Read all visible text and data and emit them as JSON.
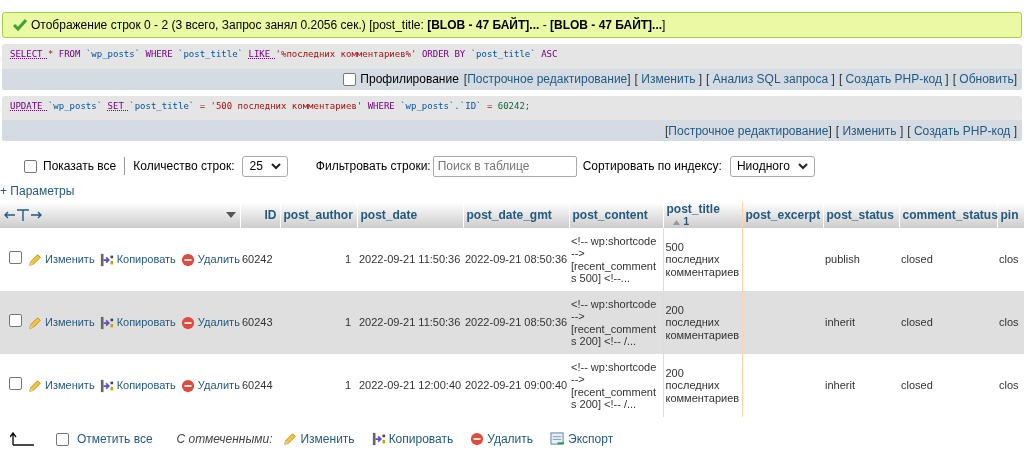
{
  "message": {
    "text": "Отображение строк 0 - 2 (3 всего, Запрос занял 0.2056 сек.) [post_title: **[BLOB - 47 БАЙТ]...** - **[BLOB - 47 БАЙТ]...**]"
  },
  "queries": [
    {
      "sql": [
        {
          "text": "SELECT",
          "kind": "keyword"
        },
        {
          "text": "*",
          "kind": "operator"
        },
        {
          "text": "FROM",
          "kind": "keyword2"
        },
        {
          "text": "`wp_posts`",
          "kind": "ident"
        },
        {
          "text": "WHERE",
          "kind": "keyword2"
        },
        {
          "text": "`post_title`",
          "kind": "ident"
        },
        {
          "text": "LIKE",
          "kind": "keyword"
        },
        {
          "text": "'%последних комментариев%'",
          "kind": "string"
        },
        {
          "text": "ORDER BY",
          "kind": "keyword2"
        },
        {
          "text": "`post_title`",
          "kind": "ident"
        },
        {
          "text": "ASC",
          "kind": "keyword2"
        }
      ],
      "profiling": {
        "label": "Профилирование",
        "checked": false
      },
      "links": [
        {
          "open": "[",
          "label": "Построчное редактирование",
          "close": "]"
        },
        {
          "open": "[ ",
          "label": "Изменить",
          "close": " ]"
        },
        {
          "open": "[ ",
          "label": "Анализ SQL запроса",
          "close": " ]"
        },
        {
          "open": "[ ",
          "label": "Создать PHP-код",
          "close": " ]"
        },
        {
          "open": "[ ",
          "label": "Обновить",
          "close": "]"
        }
      ]
    },
    {
      "sql": [
        {
          "text": "UPDATE",
          "kind": "keyword"
        },
        {
          "text": "`wp_posts`",
          "kind": "ident"
        },
        {
          "text": "SET",
          "kind": "keyword"
        },
        {
          "text": "`post_title`",
          "kind": "ident"
        },
        {
          "text": "=",
          "kind": "operator"
        },
        {
          "text": "'500 последних комментариев'",
          "kind": "string"
        },
        {
          "text": "WHERE",
          "kind": "keyword2"
        },
        {
          "text": "`wp_posts`.`ID`",
          "kind": "ident"
        },
        {
          "text": "=",
          "kind": "operator"
        },
        {
          "text": "60242;",
          "kind": "number"
        }
      ],
      "links": [
        {
          "open": "[",
          "label": "Построчное редактирование",
          "close": "]"
        },
        {
          "open": "[ ",
          "label": "Изменить",
          "close": " ]"
        },
        {
          "open": "[ ",
          "label": "Создать PHP-код",
          "close": " ]"
        }
      ]
    }
  ],
  "controls": {
    "show_all": {
      "label": "Показать все",
      "checked": false
    },
    "rows_label": "Количество строк:",
    "rows_value": "25",
    "filter_label": "Фильтровать строки:",
    "filter_placeholder": "Поиск в таблице",
    "sort_label": "Сортировать по индексу:",
    "sort_value": "Ниодного"
  },
  "options_link": "+ Параметры",
  "table": {
    "columns": [
      {
        "label": "ID",
        "sorted": false
      },
      {
        "label": "post_author",
        "sorted": false
      },
      {
        "label": "post_date",
        "sorted": false
      },
      {
        "label": "post_date_gmt",
        "sorted": false
      },
      {
        "label": "post_content",
        "sorted": false
      },
      {
        "label": "post_title",
        "sorted": true,
        "sort_order": "1"
      },
      {
        "label": "post_excerpt",
        "sorted": false
      },
      {
        "label": "post_status",
        "sorted": false
      },
      {
        "label": "comment_status",
        "sorted": false
      },
      {
        "label": "pin",
        "sorted": false
      }
    ],
    "rows": [
      {
        "checked": false,
        "actions": [
          {
            "kind": "edit",
            "label": "Изменить"
          },
          {
            "kind": "copy",
            "label": "Копировать"
          },
          {
            "kind": "delete",
            "label": "Удалить"
          }
        ],
        "cells": [
          "60242",
          "1",
          "2022-09-21 11:50:36",
          "2022-09-21 08:50:36",
          "<!-- wp:shortcode --> [recent_comments 500] <!--...",
          "500 последних комментариев",
          "",
          "publish",
          "closed",
          "clos"
        ]
      },
      {
        "checked": false,
        "actions": [
          {
            "kind": "edit",
            "label": "Изменить"
          },
          {
            "kind": "copy",
            "label": "Копировать"
          },
          {
            "kind": "delete",
            "label": "Удалить"
          }
        ],
        "cells": [
          "60243",
          "1",
          "2022-09-21 11:50:36",
          "2022-09-21 08:50:36",
          "<!-- wp:shortcode --> [recent_comments 200] <!-- /...",
          "200 последних комментариев",
          "",
          "inherit",
          "closed",
          "clos"
        ]
      },
      {
        "checked": false,
        "actions": [
          {
            "kind": "edit",
            "label": "Изменить"
          },
          {
            "kind": "copy",
            "label": "Копировать"
          },
          {
            "kind": "delete",
            "label": "Удалить"
          }
        ],
        "cells": [
          "60244",
          "1",
          "2022-09-21 12:00:40",
          "2022-09-21 09:00:40",
          "<!-- wp:shortcode --> [recent_comments 200] <!-- /...",
          "200 последних комментариев",
          "",
          "inherit",
          "closed",
          "clos"
        ]
      }
    ]
  },
  "bottom": {
    "check_all": {
      "label": "Отметить все",
      "checked": false
    },
    "with_selected": "С отмеченными:",
    "actions": [
      {
        "kind": "edit",
        "label": "Изменить"
      },
      {
        "kind": "copy",
        "label": "Копировать"
      },
      {
        "kind": "delete",
        "label": "Удалить"
      },
      {
        "kind": "export",
        "label": "Экспорт"
      }
    ]
  }
}
